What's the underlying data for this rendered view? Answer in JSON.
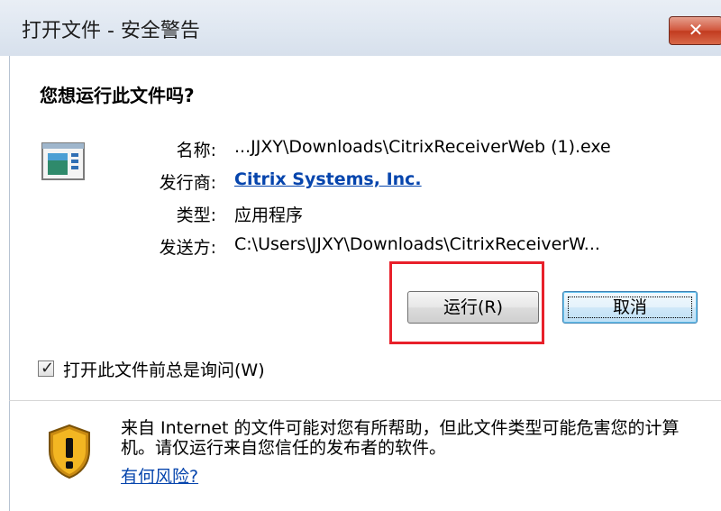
{
  "window": {
    "title": "打开文件 - 安全警告",
    "close_label": "✕"
  },
  "dialog": {
    "question": "您想运行此文件吗?",
    "fields": {
      "name_label": "名称:",
      "name_value": "...JJXY\\Downloads\\CitrixReceiverWeb (1).exe",
      "publisher_label": "发行商:",
      "publisher_value": "Citrix Systems, Inc.",
      "type_label": "类型:",
      "type_value": "应用程序",
      "from_label": "发送方:",
      "from_value": "C:\\Users\\JJXY\\Downloads\\CitrixReceiverW..."
    },
    "buttons": {
      "run": "运行(R)",
      "cancel": "取消"
    },
    "checkbox": {
      "label": "打开此文件前总是询问(W)",
      "checked": true,
      "mark": "✓"
    },
    "warning": {
      "text": "来自 Internet 的文件可能对您有所帮助，但此文件类型可能危害您的计算机。请仅运行来自您信任的发布者的软件。",
      "link": "有何风险?"
    }
  },
  "colors": {
    "highlight": "#e8202a",
    "link": "#0645ad"
  }
}
